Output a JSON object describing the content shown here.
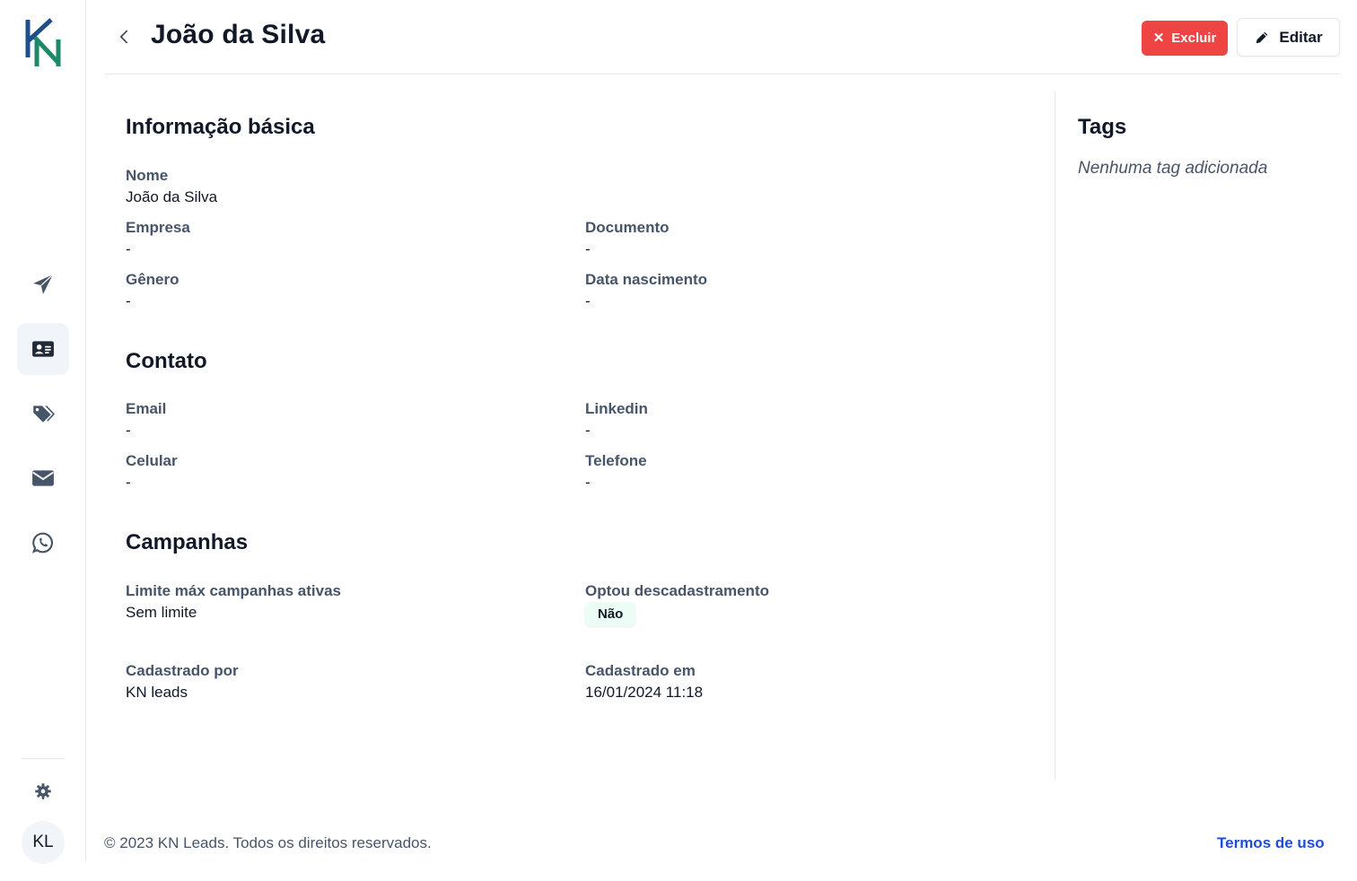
{
  "sidebar": {
    "items": [
      {
        "name": "campaigns",
        "icon": "paper-plane-icon",
        "active": false
      },
      {
        "name": "contacts",
        "icon": "id-card-icon",
        "active": true
      },
      {
        "name": "tags",
        "icon": "tags-icon",
        "active": false
      },
      {
        "name": "email",
        "icon": "envelope-icon",
        "active": false
      },
      {
        "name": "whatsapp",
        "icon": "whatsapp-icon",
        "active": false
      }
    ],
    "settings_icon": "gear-icon",
    "avatar_initials": "KL"
  },
  "header": {
    "title": "João da Silva",
    "delete_label": "Excluir",
    "edit_label": "Editar"
  },
  "basic_info": {
    "title": "Informação básica",
    "nome_label": "Nome",
    "nome_value": "João da Silva",
    "empresa_label": "Empresa",
    "empresa_value": "-",
    "documento_label": "Documento",
    "documento_value": "-",
    "genero_label": "Gênero",
    "genero_value": "-",
    "nascimento_label": "Data nascimento",
    "nascimento_value": "-"
  },
  "contact": {
    "title": "Contato",
    "email_label": "Email",
    "email_value": "-",
    "linkedin_label": "Linkedin",
    "linkedin_value": "-",
    "celular_label": "Celular",
    "celular_value": "-",
    "telefone_label": "Telefone",
    "telefone_value": "-"
  },
  "campaigns": {
    "title": "Campanhas",
    "limite_label": "Limite máx campanhas ativas",
    "limite_value": "Sem limite",
    "optou_label": "Optou descadastramento",
    "optou_value": "Não",
    "cadastrado_por_label": "Cadastrado por",
    "cadastrado_por_value": "KN leads",
    "cadastrado_em_label": "Cadastrado em",
    "cadastrado_em_value": "16/01/2024 11:18"
  },
  "tags": {
    "title": "Tags",
    "empty_text": "Nenhuma tag adicionada"
  },
  "footer": {
    "copyright": "© 2023 KN Leads. Todos os direitos reservados.",
    "terms_link": "Termos de uso"
  },
  "colors": {
    "delete": "#ef4444",
    "link": "#1d4ed8",
    "logo_blue": "#1e4f8a",
    "logo_green": "#1a8a6a",
    "badge_bg": "#ecfdf5"
  }
}
